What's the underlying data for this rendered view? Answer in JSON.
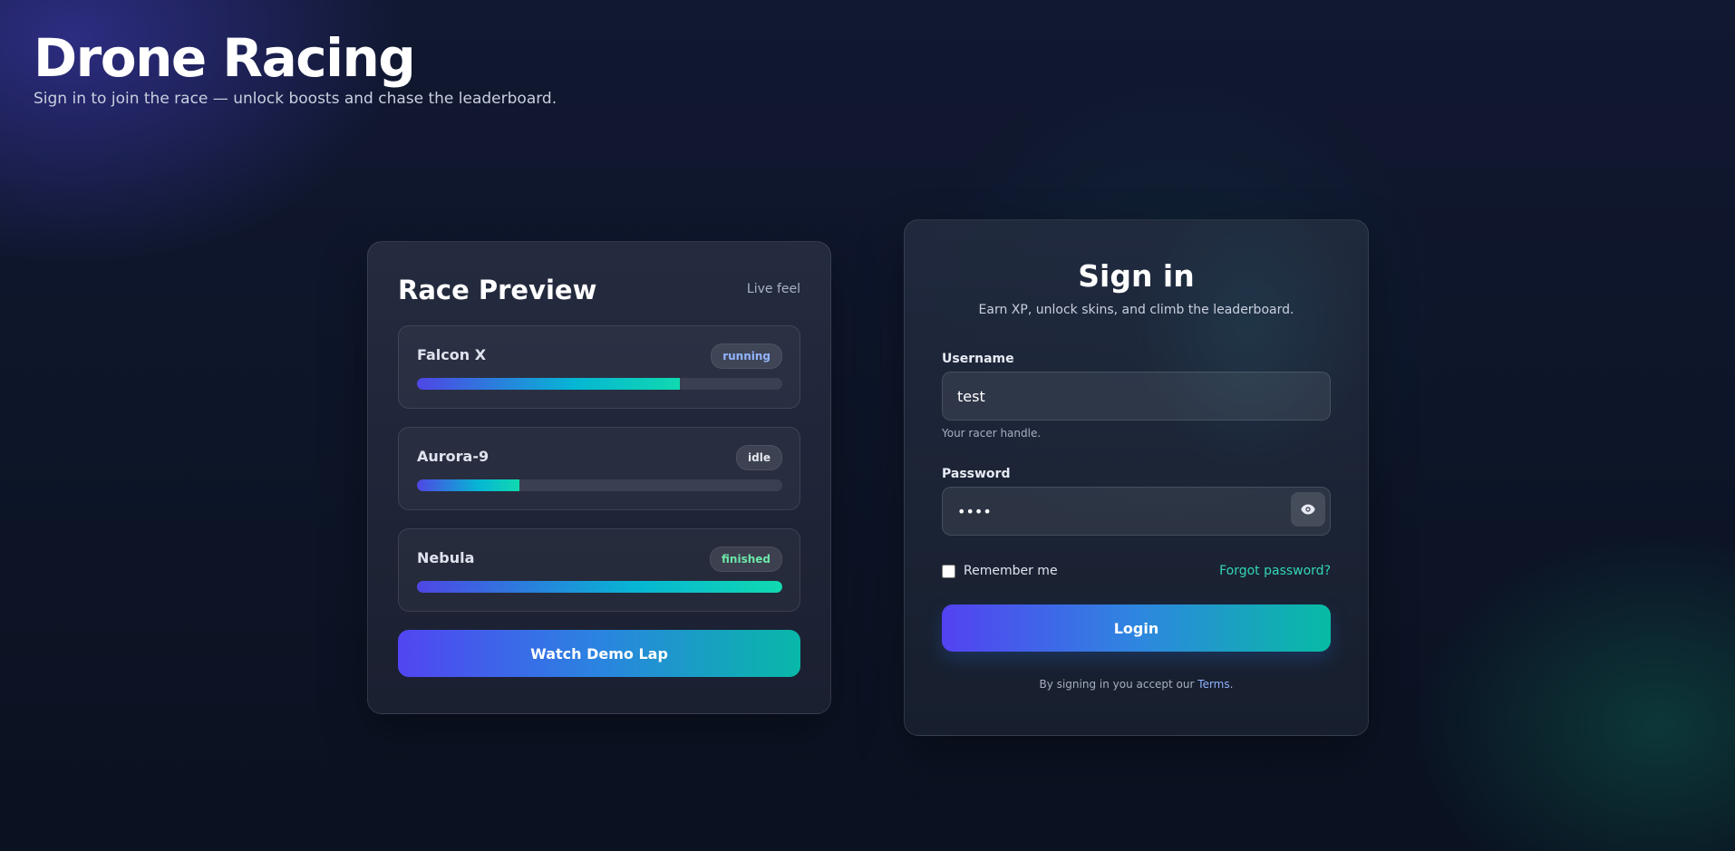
{
  "hero": {
    "title": "Drone Racing",
    "subtitle": "Sign in to join the race — unlock boosts and chase the leaderboard."
  },
  "preview": {
    "title": "Race Preview",
    "tag": "Live feel",
    "drones": [
      {
        "name": "Falcon X",
        "status": "running",
        "status_color": "#93b4ff",
        "progress": 0.72
      },
      {
        "name": "Aurora-9",
        "status": "idle",
        "status_color": "#e5e7eb",
        "progress": 0.28
      },
      {
        "name": "Nebula",
        "status": "finished",
        "status_color": "#6ee7a8",
        "progress": 1.0
      }
    ],
    "demo_button": "Watch Demo Lap"
  },
  "signin": {
    "title": "Sign in",
    "subtitle": "Earn XP, unlock skins, and climb the leaderboard.",
    "username_label": "Username",
    "username_value": "test",
    "username_help": "Your racer handle.",
    "password_label": "Password",
    "password_value": "test",
    "password_toggle_icon": "eye-icon",
    "remember_label": "Remember me",
    "remember_checked": false,
    "forgot_link": "Forgot password?",
    "login_button": "Login",
    "terms_prefix": "By signing in you accept our",
    "terms_link": "Terms",
    "terms_suffix": "."
  },
  "colors": {
    "accent_start": "#4f46e5",
    "accent_end": "#10d9b0",
    "link": "#34d6b8"
  }
}
